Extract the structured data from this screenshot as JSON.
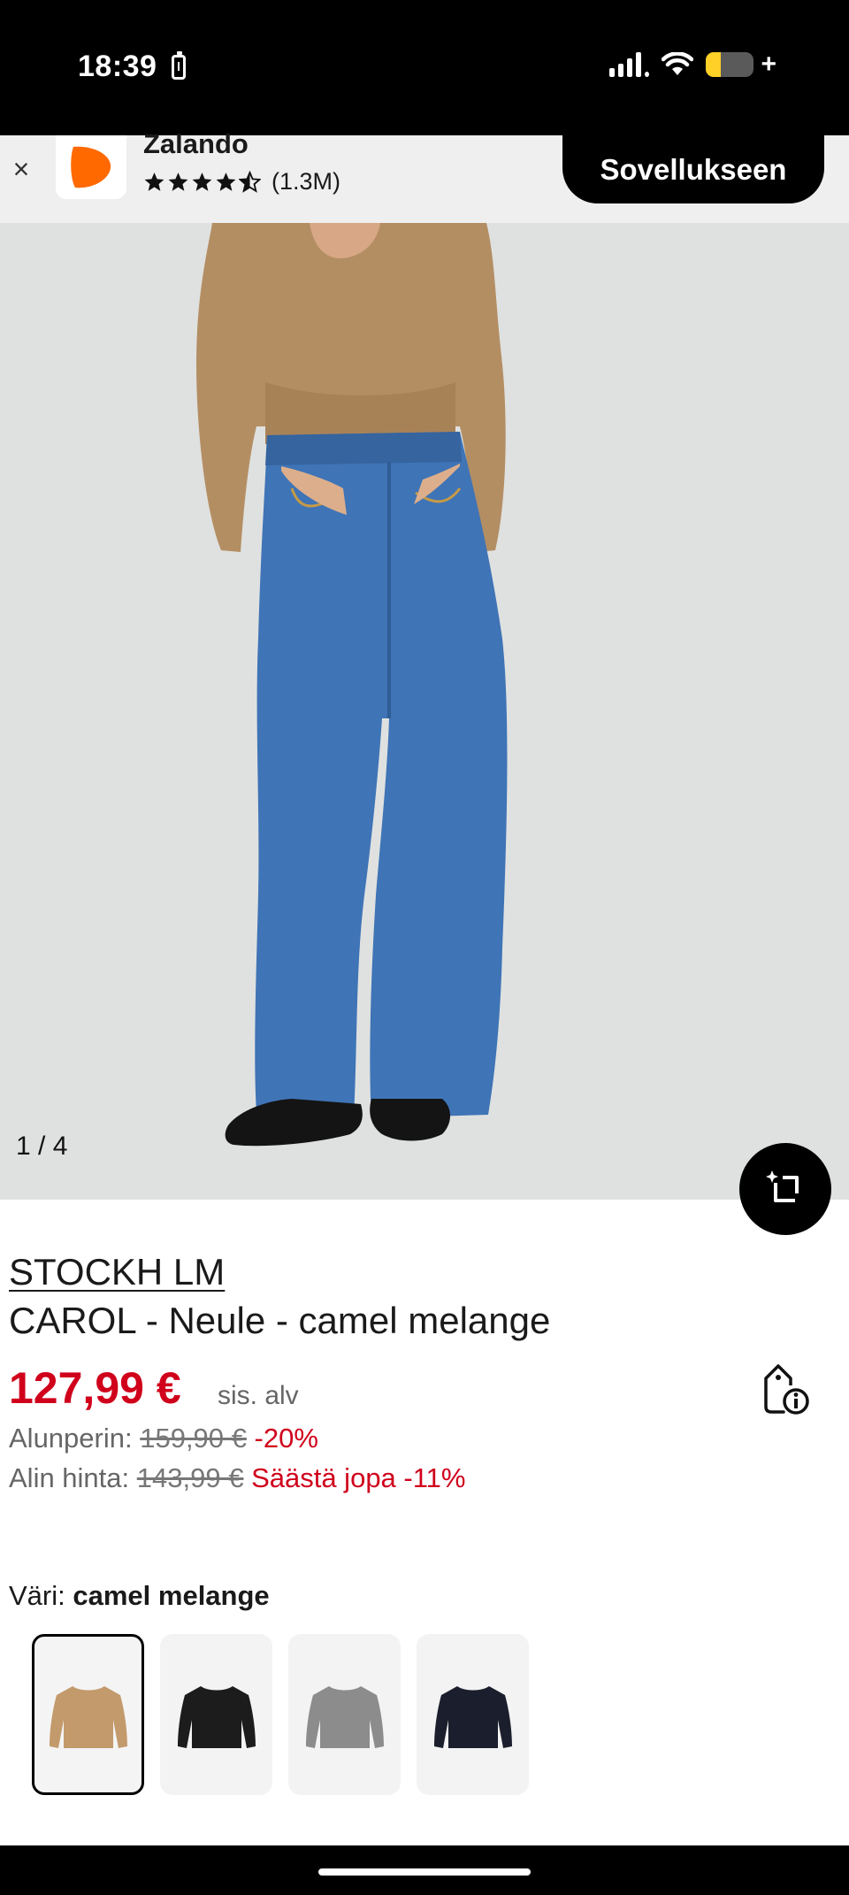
{
  "status_bar": {
    "time": "18:39",
    "battery_level": 0.3,
    "battery_color": "#ffd027"
  },
  "app_banner": {
    "close_icon": "close-icon",
    "app_name": "Zalando",
    "rating_stars": 4.5,
    "rating_count": "(1.3M)",
    "open_button": "Sovellukseen",
    "brand_color": "#ff6900"
  },
  "gallery": {
    "counter": "1 / 4",
    "shop_look_icon": "crop-sparkle-icon"
  },
  "product": {
    "brand": "STOCKH LM",
    "title": "CAROL - Neule - camel melange",
    "price": "127,99 €",
    "vat_note": "sis. alv",
    "original_label": "Alunperin:",
    "original_price": "159,90 €",
    "original_discount": "-20%",
    "lowest_label": "Alin hinta:",
    "lowest_price": "143,99 €",
    "lowest_saving": "Säästä jopa -11%",
    "price_color": "#d0011b"
  },
  "color_selector": {
    "label": "Väri:",
    "selected": "camel melange",
    "swatches": [
      {
        "name": "camel melange",
        "color": "#c39a6c",
        "selected": true
      },
      {
        "name": "black",
        "color": "#1c1c1c",
        "selected": false
      },
      {
        "name": "grey",
        "color": "#8c8c8c",
        "selected": false
      },
      {
        "name": "navy",
        "color": "#1b1e2c",
        "selected": false
      }
    ]
  }
}
